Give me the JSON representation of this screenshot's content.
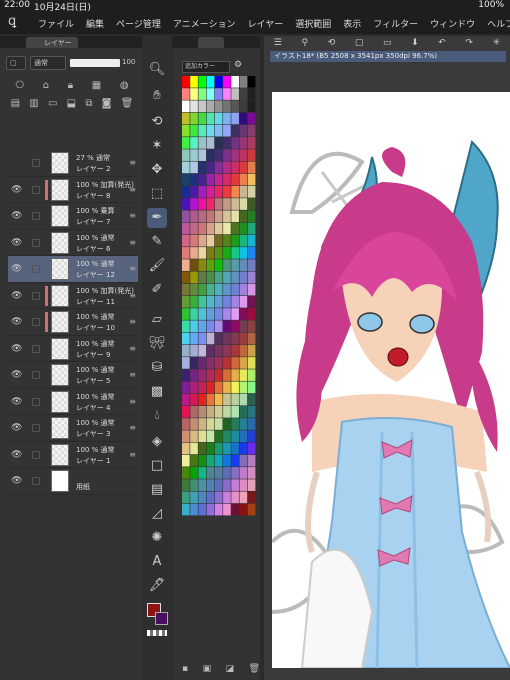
{
  "status": {
    "time": "22:00",
    "date": "10月24日(日)",
    "battery": "100%"
  },
  "menu": {
    "items": [
      "ファイル",
      "編集",
      "ページ管理",
      "アニメーション",
      "レイヤー",
      "選択範囲",
      "表示",
      "フィルター",
      "ウィンドウ",
      "ヘルプ"
    ]
  },
  "layer_panel": {
    "tab_label": "レイヤー",
    "blend_mode": "通常",
    "opacity": "100",
    "layers": [
      {
        "line1": "27 % 通常",
        "line2": "レイヤー 2",
        "visible": false,
        "clip": false,
        "selected": false
      },
      {
        "line1": "100 % 加算(発光)",
        "line2": "レイヤー 8",
        "visible": true,
        "clip": true,
        "selected": false
      },
      {
        "line1": "100 % 乗算",
        "line2": "レイヤー 7",
        "visible": true,
        "clip": false,
        "selected": false
      },
      {
        "line1": "100 % 通常",
        "line2": "レイヤー 6",
        "visible": true,
        "clip": false,
        "selected": false
      },
      {
        "line1": "100 % 通常",
        "line2": "レイヤー 12",
        "visible": true,
        "clip": false,
        "selected": true
      },
      {
        "line1": "100 % 加算(発光)",
        "line2": "レイヤー 11",
        "visible": true,
        "clip": true,
        "selected": false
      },
      {
        "line1": "100 % 通常",
        "line2": "レイヤー 10",
        "visible": true,
        "clip": true,
        "selected": false
      },
      {
        "line1": "100 % 通常",
        "line2": "レイヤー 9",
        "visible": true,
        "clip": false,
        "selected": false
      },
      {
        "line1": "100 % 通常",
        "line2": "レイヤー 5",
        "visible": true,
        "clip": false,
        "selected": false
      },
      {
        "line1": "100 % 通常",
        "line2": "レイヤー 4",
        "visible": true,
        "clip": false,
        "selected": false
      },
      {
        "line1": "100 % 通常",
        "line2": "レイヤー 3",
        "visible": true,
        "clip": false,
        "selected": false
      },
      {
        "line1": "100 % 通常",
        "line2": "レイヤー 1",
        "visible": true,
        "clip": false,
        "selected": false
      },
      {
        "line1": "",
        "line2": "用紙",
        "visible": true,
        "clip": false,
        "selected": false,
        "paper": true
      }
    ]
  },
  "palette": {
    "label": "追加カラー",
    "main_color": "#8b1515",
    "sub_color": "#4a1060"
  },
  "canvas": {
    "document_tab": "イラスト18* (B5 2508 x 3541px 350dpi 96.7%)"
  },
  "colors": {
    "accent": "#58637e",
    "hair": "#c83a8a",
    "dress": "#a8d2ef",
    "horn": "#4fa6c8"
  }
}
